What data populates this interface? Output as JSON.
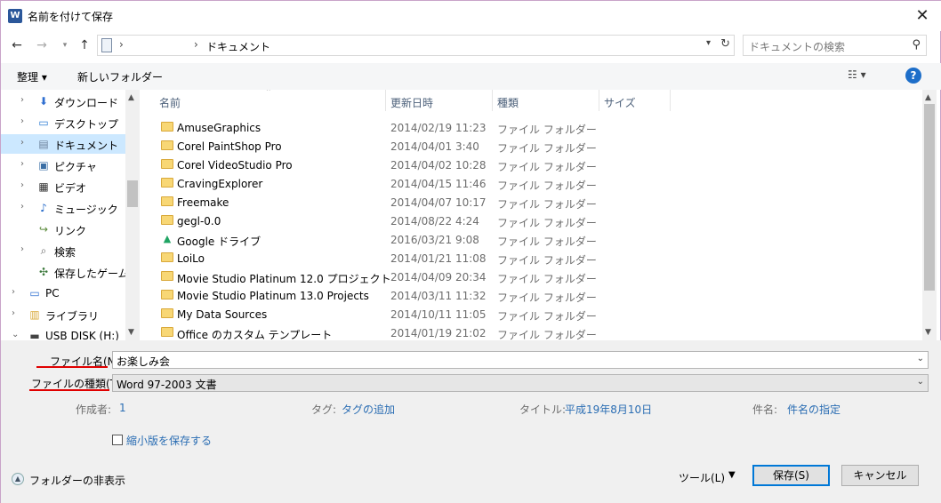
{
  "window": {
    "icon": "W",
    "title": "名前を付けて保存",
    "close": "✕"
  },
  "address": {
    "breadcrumb_current": "ドキュメント",
    "search_placeholder": "ドキュメントの検索"
  },
  "toolbar": {
    "organize": "整理 ▾",
    "new_folder": "新しいフォルダー",
    "help": "?"
  },
  "nav": {
    "items": [
      {
        "label": "ダウンロード",
        "icon": "download-icon",
        "glyph": "⬇"
      },
      {
        "label": "デスクトップ",
        "icon": "desktop-icon",
        "glyph": "▭"
      },
      {
        "label": "ドキュメント",
        "icon": "document-icon",
        "glyph": "▤"
      },
      {
        "label": "ピクチャ",
        "icon": "picture-icon",
        "glyph": "▣"
      },
      {
        "label": "ビデオ",
        "icon": "video-icon",
        "glyph": "▦"
      },
      {
        "label": "ミュージック",
        "icon": "music-icon",
        "glyph": "♪"
      },
      {
        "label": "リンク",
        "icon": "link-icon",
        "glyph": "↪"
      },
      {
        "label": "検索",
        "icon": "search-icon",
        "glyph": "⌕"
      },
      {
        "label": "保存したゲーム",
        "icon": "game-icon",
        "glyph": "✣"
      },
      {
        "label": "PC",
        "icon": "pc-icon",
        "glyph": "▭"
      },
      {
        "label": "ライブラリ",
        "icon": "library-icon",
        "glyph": "▥"
      },
      {
        "label": "USB DISK (H:)",
        "icon": "usb-drive-icon",
        "glyph": "▬"
      }
    ]
  },
  "columns": {
    "name": "名前",
    "date": "更新日時",
    "type": "種類",
    "size": "サイズ"
  },
  "files": [
    {
      "name": "AmuseGraphics",
      "date": "2014/02/19 11:23",
      "type": "ファイル フォルダー",
      "icon": "folder"
    },
    {
      "name": "Corel PaintShop Pro",
      "date": "2014/04/01 3:40",
      "type": "ファイル フォルダー",
      "icon": "folder"
    },
    {
      "name": "Corel VideoStudio Pro",
      "date": "2014/04/02 10:28",
      "type": "ファイル フォルダー",
      "icon": "folder"
    },
    {
      "name": "CravingExplorer",
      "date": "2014/04/15 11:46",
      "type": "ファイル フォルダー",
      "icon": "folder"
    },
    {
      "name": "Freemake",
      "date": "2014/04/07 10:17",
      "type": "ファイル フォルダー",
      "icon": "folder"
    },
    {
      "name": "gegl-0.0",
      "date": "2014/08/22 4:24",
      "type": "ファイル フォルダー",
      "icon": "folder"
    },
    {
      "name": "Google ドライブ",
      "date": "2016/03/21 9:08",
      "type": "ファイル フォルダー",
      "icon": "google-drive"
    },
    {
      "name": "LoiLo",
      "date": "2014/01/21 11:08",
      "type": "ファイル フォルダー",
      "icon": "folder"
    },
    {
      "name": "Movie Studio Platinum 12.0 プロジェクト",
      "date": "2014/04/09 20:34",
      "type": "ファイル フォルダー",
      "icon": "folder"
    },
    {
      "name": "Movie Studio Platinum 13.0 Projects",
      "date": "2014/03/11 11:32",
      "type": "ファイル フォルダー",
      "icon": "folder"
    },
    {
      "name": "My Data Sources",
      "date": "2014/10/11 11:05",
      "type": "ファイル フォルダー",
      "icon": "folder"
    },
    {
      "name": "Office のカスタム テンプレート",
      "date": "2014/01/19 21:02",
      "type": "ファイル フォルダー",
      "icon": "folder"
    }
  ],
  "form": {
    "filename_label": "ファイル名(N):",
    "filename_value": "お楽しみ会",
    "filetype_label": "ファイルの種類(T):",
    "filetype_value": "Word 97-2003 文書",
    "author_label": "作成者:",
    "author_value": "1",
    "tags_label": "タグ:",
    "tags_value": "タグの追加",
    "title_label": "タイトル:",
    "title_value": "平成19年8月10日",
    "subject_label": "件名:",
    "subject_value": "件名の指定",
    "thumbnail_label": "縮小版を保存する",
    "hide_folders": "フォルダーの非表示",
    "tools": "ツール(L)",
    "save": "保存(S)",
    "cancel": "キャンセル"
  },
  "colors": {
    "accent": "#0078d7",
    "link": "#2a6db3",
    "highlight": "#e00000",
    "selection": "#cce8ff"
  }
}
